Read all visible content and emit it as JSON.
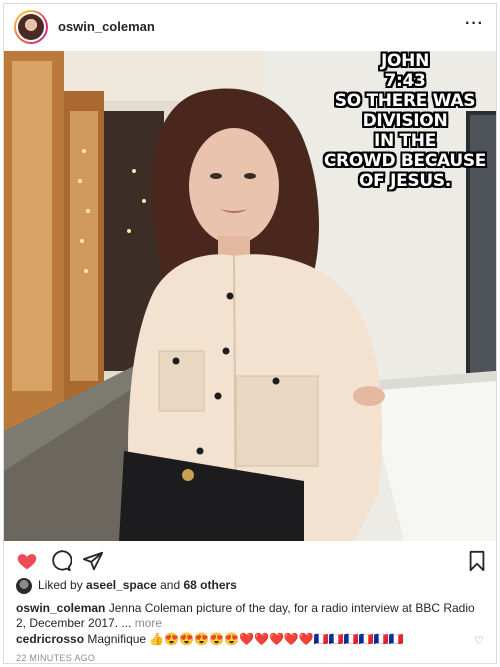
{
  "post": {
    "username": "oswin_coleman",
    "more_icon": "more-horizontal-icon"
  },
  "overlay": {
    "text": "JOHN\n7:43\nSO THERE WAS\nDIVISION\nIN THE\nCROWD BECAUSE\nOF JESUS."
  },
  "actions": {
    "like_icon": "heart-filled-icon",
    "comment_icon": "comment-icon",
    "share_icon": "share-icon",
    "save_icon": "bookmark-icon",
    "like_color": "#ed4956"
  },
  "likes": {
    "prefix": "Liked by",
    "liker": "aseel_space",
    "joiner": "and",
    "others": "68 others"
  },
  "caption": {
    "username": "oswin_coleman",
    "text": "Jenna Coleman picture of the day, for a radio interview at BBC Radio 2, December 2017. ...",
    "more": "more"
  },
  "comment": {
    "username": "cedricrosso",
    "text": "Magnifique 👍😍😍😍😍😍❤️❤️❤️❤️❤️🇫🇷🇫🇷🇫🇷🇫🇷🇫🇷🇫🇷",
    "like_icon": "heart-outline-icon"
  },
  "timestamp": "22 MINUTES AGO"
}
